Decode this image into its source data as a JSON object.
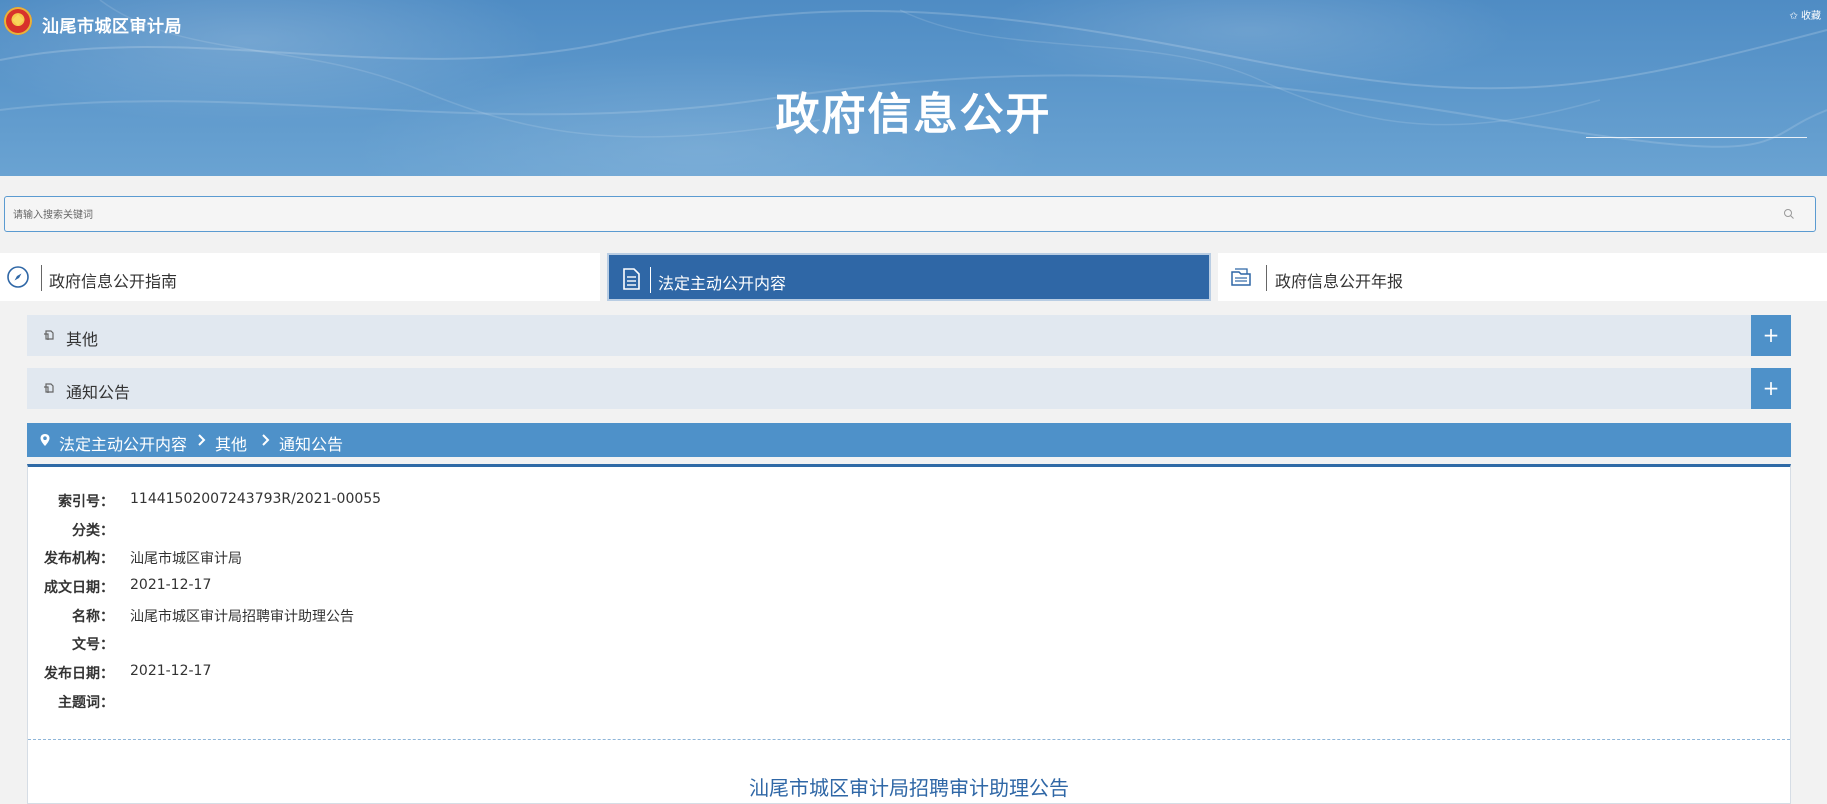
{
  "header": {
    "site_name": "汕尾市城区审计局",
    "favorite_label": "✩ 收藏",
    "banner_title": "政府信息公开"
  },
  "search": {
    "placeholder": "请输入搜索关键词"
  },
  "tabs": [
    {
      "label": "政府信息公开指南",
      "icon": "compass-icon",
      "active": false
    },
    {
      "label": "法定主动公开内容",
      "icon": "document-icon",
      "active": true
    },
    {
      "label": "政府信息公开年报",
      "icon": "folder-icon",
      "active": false
    }
  ],
  "accordion": [
    {
      "label": "其他",
      "expand": "+"
    },
    {
      "label": "通知公告",
      "expand": "+"
    }
  ],
  "breadcrumb": [
    "法定主动公开内容",
    "其他",
    "通知公告"
  ],
  "meta": [
    {
      "key": "索引号：",
      "value": "11441502007243793R/2021-00055"
    },
    {
      "key": "分类：",
      "value": ""
    },
    {
      "key": "发布机构：",
      "value": "汕尾市城区审计局"
    },
    {
      "key": "成文日期：",
      "value": "2021-12-17"
    },
    {
      "key": "名称：",
      "value": "汕尾市城区审计局招聘审计助理公告"
    },
    {
      "key": "文号：",
      "value": ""
    },
    {
      "key": "发布日期：",
      "value": "2021-12-17"
    },
    {
      "key": "主题词：",
      "value": ""
    }
  ],
  "document": {
    "title": "汕尾市城区审计局招聘审计助理公告"
  },
  "colors": {
    "banner": "#5a96cb",
    "active_tab": "#2f67a6",
    "accent": "#4e91c9",
    "accordion_bg": "#e1e8f0"
  }
}
